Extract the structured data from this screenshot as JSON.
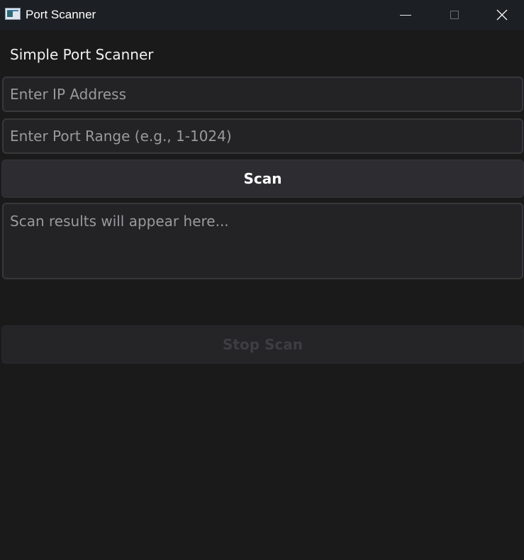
{
  "window": {
    "title": "Port Scanner",
    "icon": "app-window-icon",
    "controls": [
      "minimize-icon",
      "maximize-icon",
      "close-icon"
    ]
  },
  "main": {
    "heading": "Simple Port Scanner",
    "ip_input": {
      "placeholder": "Enter IP Address",
      "value": ""
    },
    "port_input": {
      "placeholder": "Enter Port Range (e.g., 1-1024)",
      "value": ""
    },
    "scan_button": {
      "label": "Scan"
    },
    "results": {
      "text": "Scan results will appear here..."
    },
    "stop_button": {
      "label": "Stop Scan",
      "disabled": true
    }
  },
  "colors": {
    "background": "#1a1a1b",
    "titlebar": "#1c2024",
    "field_background": "#232326",
    "button_background": "#2d2d31"
  }
}
